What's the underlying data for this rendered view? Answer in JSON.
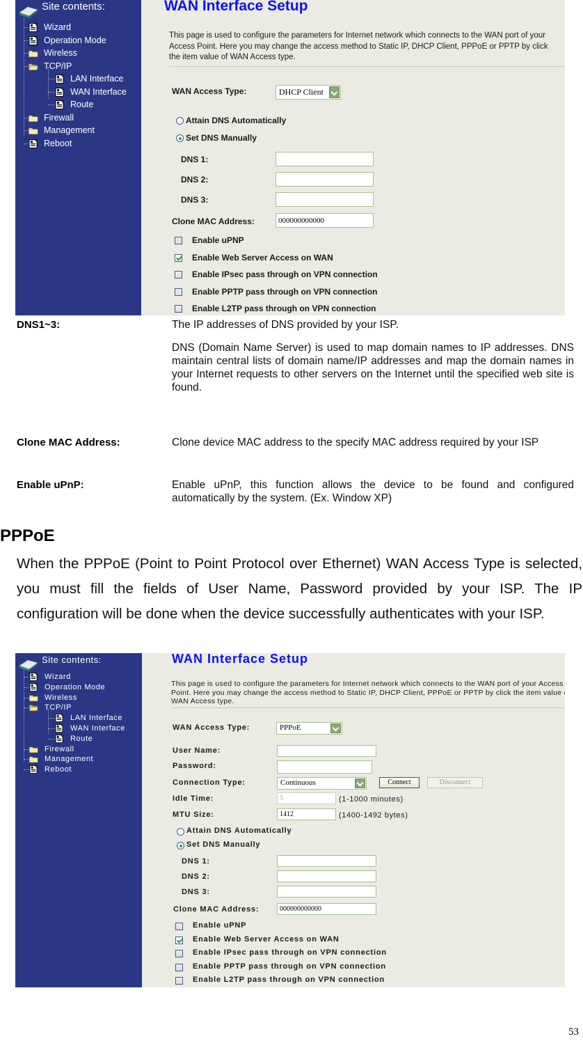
{
  "screenshot_common": {
    "site_contents_label": "Site contents:",
    "nav": [
      {
        "label": "Wizard",
        "icon": "page-icon",
        "level": 0
      },
      {
        "label": "Operation Mode",
        "icon": "page-icon",
        "level": 0
      },
      {
        "label": "Wireless",
        "icon": "folder-icon",
        "level": 0
      },
      {
        "label": "TCP/IP",
        "icon": "folder-open-icon",
        "level": 0
      },
      {
        "label": "LAN Interface",
        "icon": "page-icon",
        "level": 1
      },
      {
        "label": "WAN Interface",
        "icon": "page-icon",
        "level": 1
      },
      {
        "label": "Route",
        "icon": "page-icon",
        "level": 1
      },
      {
        "label": "Firewall",
        "icon": "folder-icon",
        "level": 0
      },
      {
        "label": "Management",
        "icon": "folder-icon",
        "level": 0
      },
      {
        "label": "Reboot",
        "icon": "page-icon",
        "level": 0
      }
    ],
    "page_title": "WAN Interface Setup",
    "description": "This page is used to configure the parameters for Internet network which connects to the WAN port of your Access Point. Here you may change the access method to Static IP, DHCP Client, PPPoE or PPTP by click the item value of WAN Access type.",
    "colors": {
      "sidebar": "#2b3785",
      "content_bg": "#ebebe3",
      "title": "#0b10f2"
    }
  },
  "screenshot1": {
    "wan_access_type_label": "WAN Access Type:",
    "wan_access_type_value": "DHCP Client",
    "dns_auto_label": "Attain DNS Automatically",
    "dns_manual_label": "Set DNS Manually",
    "dns_mode": "manual",
    "dns1_label": "DNS 1:",
    "dns1_value": "",
    "dns2_label": "DNS 2:",
    "dns2_value": "",
    "dns3_label": "DNS 3:",
    "dns3_value": "",
    "clone_mac_label": "Clone MAC Address:",
    "clone_mac_value": "000000000000",
    "checkboxes": [
      {
        "label": "Enable uPNP",
        "checked": false
      },
      {
        "label": "Enable Web Server Access on WAN",
        "checked": true
      },
      {
        "label": "Enable IPsec pass through on VPN connection",
        "checked": false
      },
      {
        "label": "Enable PPTP pass through on VPN connection",
        "checked": false
      },
      {
        "label": "Enable L2TP pass through on VPN connection",
        "checked": false
      }
    ]
  },
  "definitions": [
    {
      "term": "DNS1~3:",
      "paragraphs": [
        "The IP addresses of DNS provided by your ISP.",
        "DNS (Domain Name Server) is used to map domain names to IP addresses. DNS maintain central lists of domain name/IP addresses and map the domain names in your Internet requests to other servers on the Internet until the specified web site is found."
      ]
    },
    {
      "term": "Clone MAC Address:",
      "paragraphs": [
        "Clone device MAC address to the specify MAC address required by your ISP"
      ]
    },
    {
      "term": "Enable uPnP:",
      "paragraphs": [
        "Enable uPnP, this function allows  the device to be found and configured automatically by the system. (Ex. Window XP)"
      ]
    }
  ],
  "section": {
    "title": "PPPoE",
    "paragraph": "When the PPPoE (Point to Point Protocol over Ethernet) WAN Access Type is selected, you must fill the fields of User Name, Password provided by your ISP. The IP configuration will be done when the device successfully authenticates with your ISP."
  },
  "screenshot2": {
    "wan_access_type_label": "WAN Access Type:",
    "wan_access_type_value": "PPPoE",
    "user_name_label": "User Name:",
    "user_name_value": "",
    "password_label": "Password:",
    "password_value": "",
    "connection_type_label": "Connection Type:",
    "connection_type_value": "Continuous",
    "connect_button": "Connect",
    "disconnect_button": "Disconnect",
    "idle_time_label": "Idle Time:",
    "idle_time_value": "5",
    "idle_time_hint": "(1-1000 minutes)",
    "mtu_label": "MTU Size:",
    "mtu_value": "1412",
    "mtu_hint": "(1400-1492 bytes)",
    "dns_auto_label": "Attain DNS Automatically",
    "dns_manual_label": "Set DNS Manually",
    "dns_mode": "manual",
    "dns1_label": "DNS 1:",
    "dns1_value": "",
    "dns2_label": "DNS 2:",
    "dns2_value": "",
    "dns3_label": "DNS 3:",
    "dns3_value": "",
    "clone_mac_label": "Clone MAC Address:",
    "clone_mac_value": "000000000000",
    "checkboxes": [
      {
        "label": "Enable uPNP",
        "checked": false
      },
      {
        "label": "Enable Web Server Access on WAN",
        "checked": true
      },
      {
        "label": "Enable IPsec pass through on VPN connection",
        "checked": false
      },
      {
        "label": "Enable PPTP pass through on VPN connection",
        "checked": false
      },
      {
        "label": "Enable L2TP pass through on VPN connection",
        "checked": false
      }
    ]
  },
  "page_number": "53"
}
